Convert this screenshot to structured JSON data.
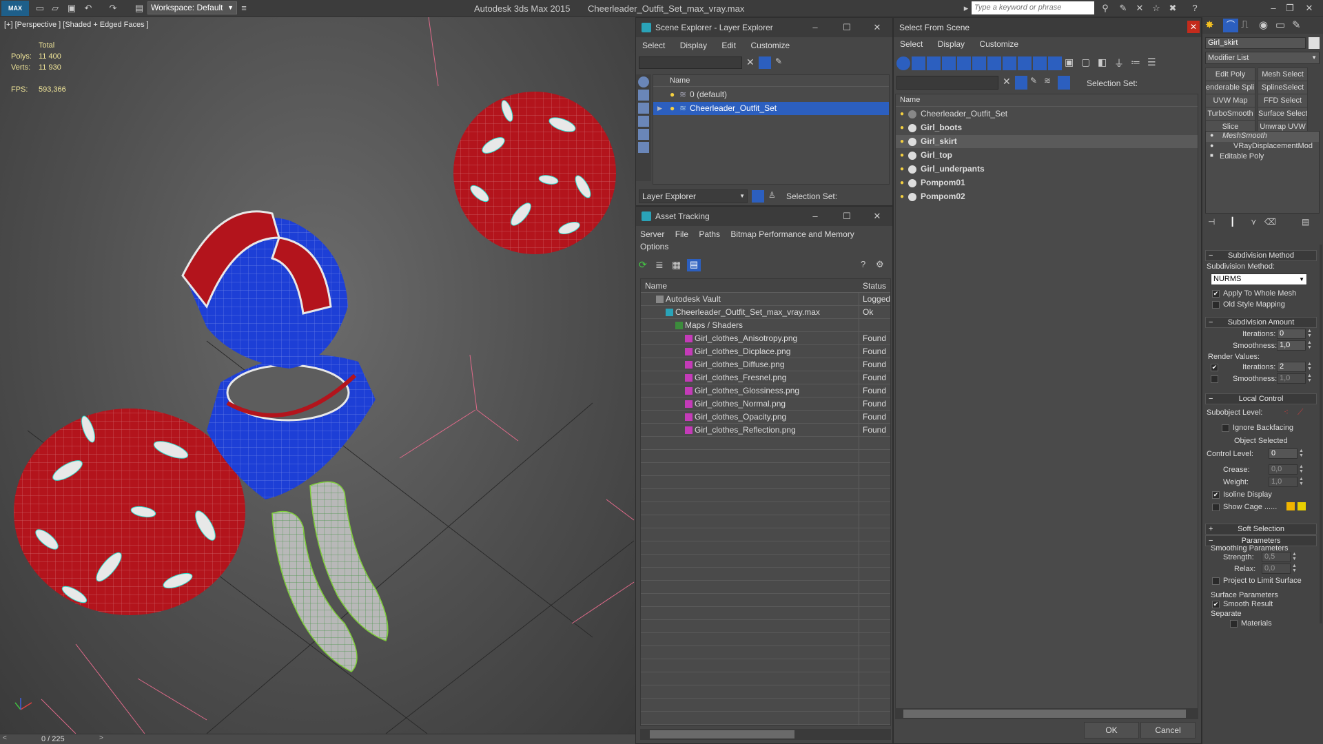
{
  "titlebar": {
    "workspace": "Workspace: Default",
    "app_title": "Autodesk 3ds Max  2015",
    "file_title": "Cheerleader_Outfit_Set_max_vray.max",
    "search_placeholder": "Type a keyword or phrase",
    "logo": "MAX"
  },
  "viewport": {
    "label": "[+] [Perspective ] [Shaded + Edged Faces ]",
    "stats": {
      "total_label": "Total",
      "polys_label": "Polys:",
      "polys_value": "11 400",
      "verts_label": "Verts:",
      "verts_value": "11 930",
      "fps_label": "FPS:",
      "fps_value": "593,366"
    },
    "timeline": "0 / 225"
  },
  "scene_explorer": {
    "title": "Scene Explorer - Layer Explorer",
    "menu": [
      "Select",
      "Display",
      "Edit",
      "Customize"
    ],
    "column": "Name",
    "rows": [
      {
        "label": "0 (default)",
        "selected": false
      },
      {
        "label": "Cheerleader_Outfit_Set",
        "selected": true
      }
    ],
    "footer_dropdown": "Layer Explorer",
    "selection_set_label": "Selection Set:"
  },
  "asset_tracking": {
    "title": "Asset Tracking",
    "menu": [
      "Server",
      "File",
      "Paths",
      "Bitmap Performance and Memory"
    ],
    "menu2": [
      "Options"
    ],
    "columns": [
      "Name",
      "Status"
    ],
    "rows": [
      {
        "name": "Autodesk Vault",
        "status": "Logged",
        "indent": 1
      },
      {
        "name": "Cheerleader_Outfit_Set_max_vray.max",
        "status": "Ok",
        "indent": 2
      },
      {
        "name": "Maps / Shaders",
        "status": "",
        "indent": 3
      },
      {
        "name": "Girl_clothes_Anisotropy.png",
        "status": "Found",
        "indent": 4
      },
      {
        "name": "Girl_clothes_Dicplace.png",
        "status": "Found",
        "indent": 4
      },
      {
        "name": "Girl_clothes_Diffuse.png",
        "status": "Found",
        "indent": 4
      },
      {
        "name": "Girl_clothes_Fresnel.png",
        "status": "Found",
        "indent": 4
      },
      {
        "name": "Girl_clothes_Glossiness.png",
        "status": "Found",
        "indent": 4
      },
      {
        "name": "Girl_clothes_Normal.png",
        "status": "Found",
        "indent": 4
      },
      {
        "name": "Girl_clothes_Opacity.png",
        "status": "Found",
        "indent": 4
      },
      {
        "name": "Girl_clothes_Reflection.png",
        "status": "Found",
        "indent": 4
      }
    ]
  },
  "select_from_scene": {
    "title": "Select From Scene",
    "menu": [
      "Select",
      "Display",
      "Customize"
    ],
    "selection_set_label": "Selection Set:",
    "column": "Name",
    "rows": [
      {
        "label": "Cheerleader_Outfit_Set",
        "bold": false,
        "selected": false
      },
      {
        "label": "Girl_boots",
        "bold": true,
        "selected": false
      },
      {
        "label": "Girl_skirt",
        "bold": true,
        "selected": true
      },
      {
        "label": "Girl_top",
        "bold": true,
        "selected": false
      },
      {
        "label": "Girl_underpants",
        "bold": true,
        "selected": false
      },
      {
        "label": "Pompom01",
        "bold": true,
        "selected": false
      },
      {
        "label": "Pompom02",
        "bold": true,
        "selected": false
      }
    ],
    "ok": "OK",
    "cancel": "Cancel"
  },
  "command_panel": {
    "object_name": "Girl_skirt",
    "modifier_list": "Modifier List",
    "buttons": [
      "Edit Poly",
      "Mesh Select",
      "enderable Splir",
      "SplineSelect",
      "UVW Map",
      "FFD Select",
      "TurboSmooth",
      "Surface Select",
      "Slice",
      "Unwrap UVW"
    ],
    "stack": [
      "MeshSmooth",
      "VRayDisplacementMod",
      "Editable Poly"
    ],
    "subdivision_method": {
      "header": "Subdivision Method",
      "label": "Subdivision Method:",
      "value": "NURMS",
      "apply_whole": "Apply To Whole Mesh",
      "apply_whole_checked": true,
      "old_style": "Old Style Mapping",
      "old_style_checked": false
    },
    "subdivision_amount": {
      "header": "Subdivision Amount",
      "iterations_label": "Iterations:",
      "iterations": "0",
      "smoothness_label": "Smoothness:",
      "smoothness": "1,0",
      "render_values": "Render Values:",
      "r_iterations_label": "Iterations:",
      "r_iterations": "2",
      "r_iterations_checked": true,
      "r_smoothness_label": "Smoothness:",
      "r_smoothness": "1,0",
      "r_smoothness_checked": false
    },
    "local_control": {
      "header": "Local Control",
      "subobject_label": "Subobject Level:",
      "ignore_backfacing": "Ignore Backfacing",
      "object_selected": "Object Selected",
      "control_level_label": "Control Level:",
      "control_level": "0",
      "crease_label": "Crease:",
      "crease": "0,0",
      "weight_label": "Weight:",
      "weight": "1,0",
      "isoline": "Isoline Display",
      "isoline_checked": true,
      "show_cage": "Show Cage ......",
      "show_cage_checked": false,
      "cage_color1": "#f0b400",
      "cage_color2": "#e8d000"
    },
    "soft_selection": {
      "header": "Soft Selection"
    },
    "parameters": {
      "header": "Parameters",
      "smoothing_params": "Smoothing Parameters",
      "strength_label": "Strength:",
      "strength": "0,5",
      "relax_label": "Relax:",
      "relax": "0,0",
      "project": "Project to Limit Surface",
      "surface_params": "Surface Parameters",
      "smooth_result": "Smooth Result",
      "smooth_result_checked": true,
      "separate": "Separate",
      "materials": "Materials"
    }
  },
  "colors": {
    "accent_blue": "#2c5fbf",
    "selection_row": "#5a5a5a",
    "stat_yellow": "#f2e79a",
    "pompom_red": "#b3141c",
    "boots_green": "#7ecf3a",
    "top_blue": "#1d3fd6"
  }
}
